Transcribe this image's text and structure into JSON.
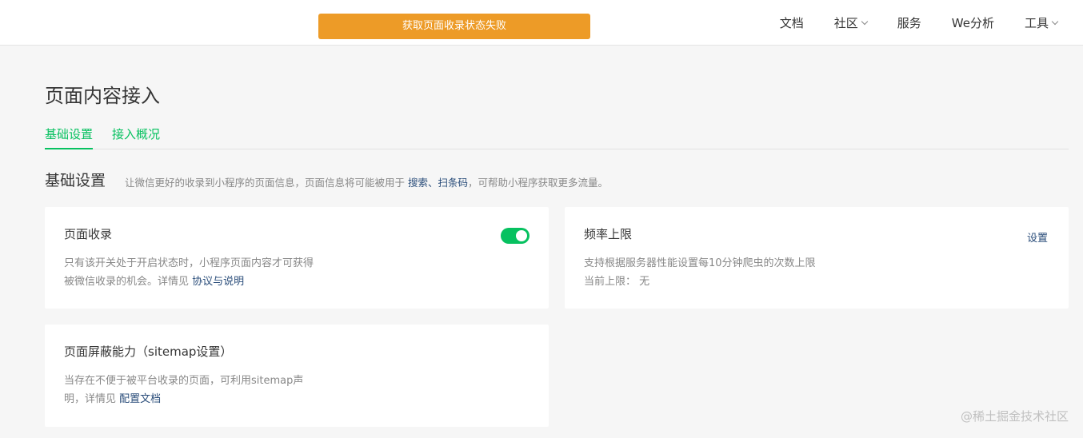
{
  "alert": {
    "text": "获取页面收录状态失败",
    "color": "#ed9b27"
  },
  "nav": {
    "items": [
      {
        "label": "文档",
        "has_dropdown": false
      },
      {
        "label": "社区",
        "has_dropdown": true
      },
      {
        "label": "服务",
        "has_dropdown": false
      },
      {
        "label": "We分析",
        "has_dropdown": false
      },
      {
        "label": "工具",
        "has_dropdown": true
      }
    ]
  },
  "page": {
    "title": "页面内容接入"
  },
  "tabs": [
    {
      "label": "基础设置",
      "active": true
    },
    {
      "label": "接入概况",
      "active": false
    }
  ],
  "section": {
    "title": "基础设置",
    "desc_prefix": "让微信更好的收录到小程序的页面信息，页面信息将可能被用于",
    "desc_link": "搜索、扫条码",
    "desc_suffix": "，可帮助小程序获取更多流量。"
  },
  "cards": {
    "indexing": {
      "title": "页面收录",
      "line1": "只有该开关处于开启状态时，小程序页面内容才可获得",
      "line2_prefix": "被微信收录的机会。详情见",
      "line2_link": "协议与说明",
      "toggle_on": true
    },
    "rate_limit": {
      "title": "频率上限",
      "action": "设置",
      "line1": "支持根据服务器性能设置每10分钟爬虫的次数上限",
      "line2_label": "当前上限：",
      "line2_value": "无"
    },
    "sitemap": {
      "title": "页面屏蔽能力（sitemap设置）",
      "line1": "当存在不便于被平台收录的页面，可利用sitemap声",
      "line2_prefix": "明，详情见",
      "line2_link": "配置文档"
    }
  },
  "watermark": "@稀土掘金技术社区",
  "colors": {
    "accent": "#07c160",
    "link": "#2a4d7a",
    "warning": "#ed9b27"
  }
}
